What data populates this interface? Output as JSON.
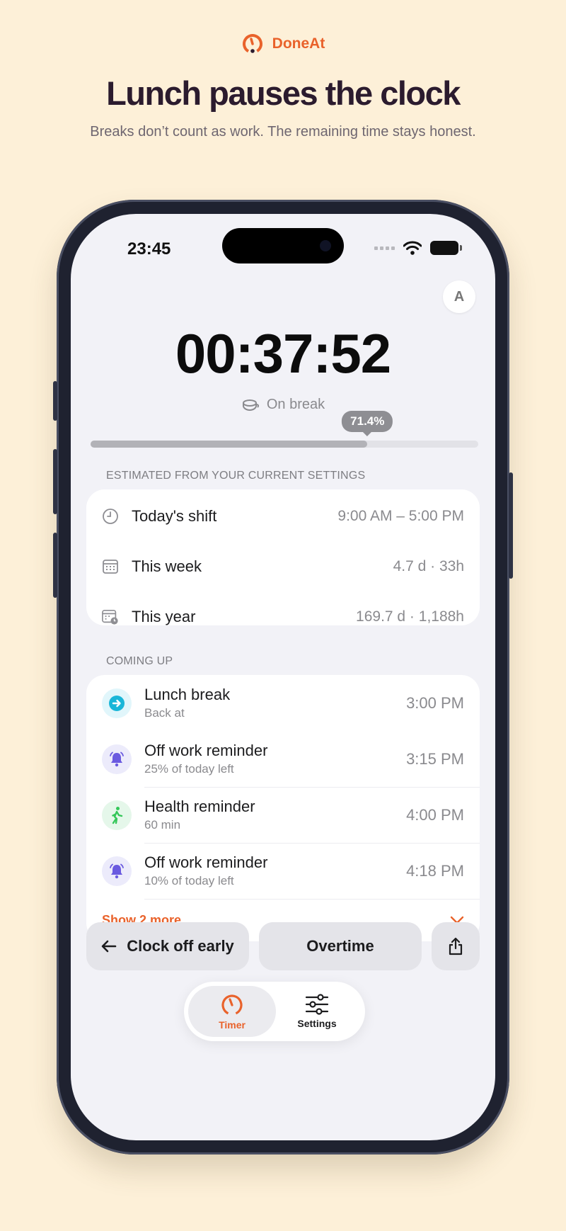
{
  "brand": {
    "name": "DoneAt",
    "accent": "#e9622b"
  },
  "hero": {
    "title": "Lunch pauses the clock",
    "subtitle": "Breaks don’t count as work. The remaining time stays honest."
  },
  "status_bar": {
    "time": "23:45",
    "icons": [
      "signal-dots-icon",
      "wifi-icon",
      "battery-icon"
    ]
  },
  "avatar": {
    "initial": "A"
  },
  "timer": {
    "value": "00:37:52",
    "status": "On break",
    "status_icon": "coffee-cup-icon"
  },
  "progress": {
    "label": "71.4%",
    "value": 71.4
  },
  "estimates": {
    "title": "ESTIMATED FROM YOUR CURRENT SETTINGS",
    "rows": [
      {
        "icon": "clock-icon",
        "label": "Today's shift",
        "value": "9:00 AM – 5:00 PM"
      },
      {
        "icon": "calendar-icon",
        "label": "This week",
        "value": "4.7 d · 33h"
      },
      {
        "icon": "calendar-clock-icon",
        "label": "This year",
        "value": "169.7 d · 1,188h"
      }
    ]
  },
  "upcoming": {
    "title": "COMING UP",
    "items": [
      {
        "icon": "arrow-right-circle-icon",
        "title": "Lunch break",
        "subtitle": "Back at",
        "time": "3:00 PM",
        "color": "#1ab6d8",
        "bg": "#e1f6fb"
      },
      {
        "icon": "bell-icon",
        "title": "Off work reminder",
        "subtitle": "25% of today left",
        "time": "3:15 PM",
        "color": "#6a5ae0",
        "bg": "#ecebfb"
      },
      {
        "icon": "walking-person-icon",
        "title": "Health reminder",
        "subtitle": "60 min",
        "time": "4:00 PM",
        "color": "#34c759",
        "bg": "#e5f7ea"
      },
      {
        "icon": "bell-icon",
        "title": "Off work reminder",
        "subtitle": "10% of today left",
        "time": "4:18 PM",
        "color": "#6a5ae0",
        "bg": "#ecebfb"
      }
    ],
    "show_more": "Show 2 more"
  },
  "actions": {
    "clock_off": "Clock off early",
    "overtime": "Overtime",
    "share_icon": "share-icon"
  },
  "tabs": [
    {
      "label": "Timer",
      "icon": "timer-icon",
      "active": true
    },
    {
      "label": "Settings",
      "icon": "sliders-icon",
      "active": false
    }
  ]
}
